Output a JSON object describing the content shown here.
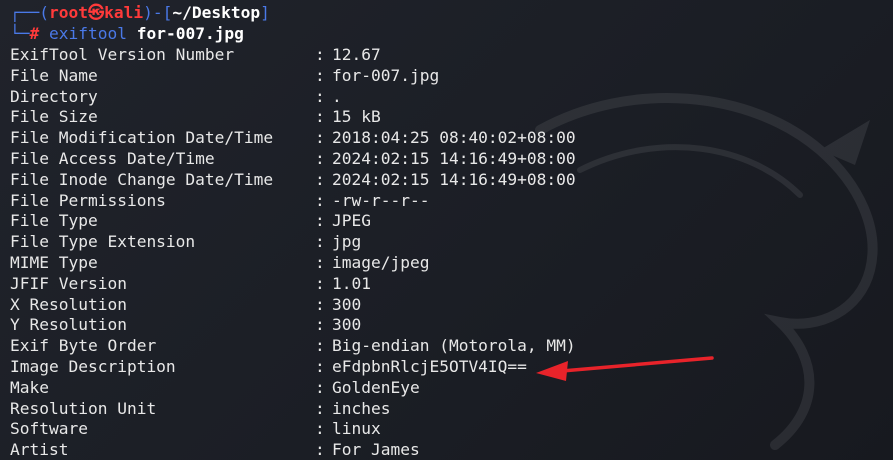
{
  "prompt": {
    "open": "┌──(",
    "user": "root",
    "at": "㉿",
    "host": "kali",
    "mid": ")-[",
    "path": "~/Desktop",
    "close": "]",
    "line2_prefix": "└─",
    "hash": "#",
    "command": "exiftool",
    "argument": "for-007.jpg"
  },
  "rows": [
    {
      "key": "ExifTool Version Number",
      "value": "12.67"
    },
    {
      "key": "File Name",
      "value": "for-007.jpg"
    },
    {
      "key": "Directory",
      "value": "."
    },
    {
      "key": "File Size",
      "value": "15 kB"
    },
    {
      "key": "File Modification Date/Time",
      "value": "2018:04:25 08:40:02+08:00"
    },
    {
      "key": "File Access Date/Time",
      "value": "2024:02:15 14:16:49+08:00"
    },
    {
      "key": "File Inode Change Date/Time",
      "value": "2024:02:15 14:16:49+08:00"
    },
    {
      "key": "File Permissions",
      "value": "-rw-r--r--"
    },
    {
      "key": "File Type",
      "value": "JPEG"
    },
    {
      "key": "File Type Extension",
      "value": "jpg"
    },
    {
      "key": "MIME Type",
      "value": "image/jpeg"
    },
    {
      "key": "JFIF Version",
      "value": "1.01"
    },
    {
      "key": "X Resolution",
      "value": "300"
    },
    {
      "key": "Y Resolution",
      "value": "300"
    },
    {
      "key": "Exif Byte Order",
      "value": "Big-endian (Motorola, MM)"
    },
    {
      "key": "Image Description",
      "value": "eFdpbnRlcjE5OTV4IQ=="
    },
    {
      "key": "Make",
      "value": "GoldenEye"
    },
    {
      "key": "Resolution Unit",
      "value": "inches"
    },
    {
      "key": "Software",
      "value": "linux"
    },
    {
      "key": "Artist",
      "value": "For James"
    }
  ],
  "separator": ":",
  "colors": {
    "background": "#1c1f26",
    "text": "#e8e8e8",
    "prompt_bracket": "#4a79e8",
    "prompt_user": "#ff3a3a",
    "annotation_arrow": "#e8232a"
  },
  "icons": {
    "watermark": "kali-dragon-icon",
    "annotation": "red-arrow-icon"
  }
}
